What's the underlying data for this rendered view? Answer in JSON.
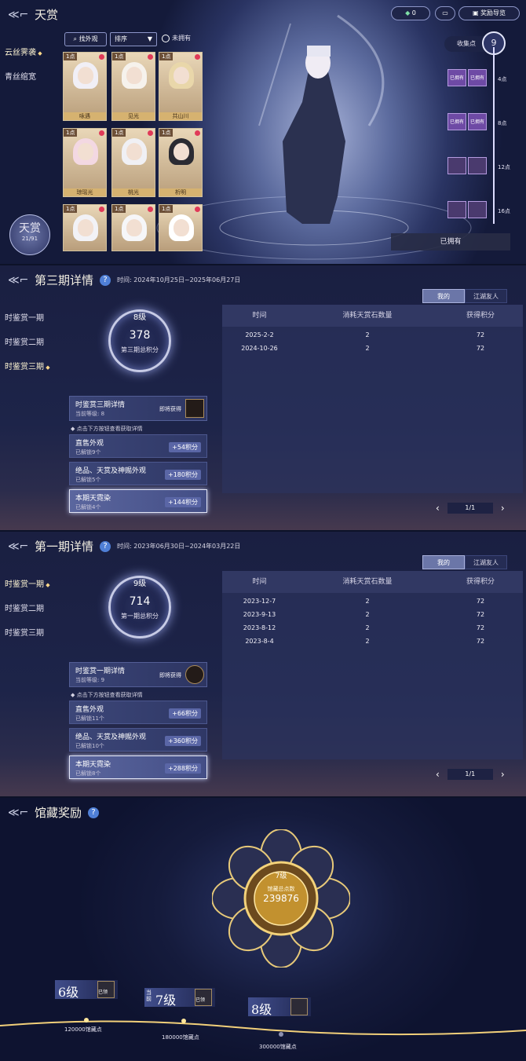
{
  "top": {
    "title": "天赏",
    "currency_value": "0",
    "reward_guide": "奖励导览",
    "categories": [
      "云丝霁袭",
      "青丝绾宽"
    ],
    "filter": {
      "find_look": "找外观",
      "sort": "排序",
      "not_owned": "未拥有"
    },
    "items": [
      {
        "badge": "1点",
        "name": "咏遇"
      },
      {
        "badge": "1点",
        "name": "见光"
      },
      {
        "badge": "1点",
        "name": "共山川"
      },
      {
        "badge": "1点",
        "name": "琼瑶光"
      },
      {
        "badge": "1点",
        "name": "桃光"
      },
      {
        "badge": "1点",
        "name": "析明"
      },
      {
        "badge": "1点",
        "name": ""
      },
      {
        "badge": "1点",
        "name": ""
      },
      {
        "badge": "1点",
        "name": ""
      }
    ],
    "tianshang_badge": {
      "title": "天赏",
      "count": "21/91"
    },
    "collect_label": "收集点",
    "collect_value": "9",
    "milestones": [
      "4点",
      "8点",
      "12点",
      "16点"
    ],
    "owned_tag": "已拥有",
    "owned_button": "已拥有"
  },
  "period3": {
    "title": "第三期详情",
    "time": "时间: 2024年10月25日~2025年06月27日",
    "side": [
      "时鉴赏一期",
      "时鉴赏二期",
      "时鉴赏三期"
    ],
    "ring": {
      "level": "8级",
      "score": "378",
      "caption": "第三期总积分"
    },
    "detail": {
      "title": "时鉴赏三期详情",
      "sub": "当前等级: 8",
      "right": "即将获得"
    },
    "hint": "点击下方按钮查看获取详情",
    "cards": [
      {
        "title": "直售外观",
        "sub": "已解锁9个",
        "points": "+54积分"
      },
      {
        "title": "绝品、天赏及神赐外观",
        "sub": "已解锁5个",
        "points": "+180积分"
      },
      {
        "title": "本期天霓染",
        "sub": "已解锁4个",
        "points": "+144积分"
      }
    ],
    "toggle": [
      "我的",
      "江湖友人"
    ],
    "headers": [
      "时间",
      "消耗天赏石数量",
      "获得积分"
    ],
    "rows": [
      [
        "2025-2-2",
        "2",
        "72"
      ],
      [
        "2024-10-26",
        "2",
        "72"
      ]
    ],
    "page": "1/1"
  },
  "period1": {
    "title": "第一期详情",
    "time": "时间: 2023年06月30日~2024年03月22日",
    "side": [
      "时鉴赏一期",
      "时鉴赏二期",
      "时鉴赏三期"
    ],
    "ring": {
      "level": "9级",
      "score": "714",
      "caption": "第一期总积分"
    },
    "detail": {
      "title": "时鉴赏一期详情",
      "sub": "当前等级: 9",
      "right": "即将获得"
    },
    "hint": "点击下方按钮查看获取详情",
    "cards": [
      {
        "title": "直售外观",
        "sub": "已解锁11个",
        "points": "+66积分"
      },
      {
        "title": "绝品、天赏及神赐外观",
        "sub": "已解锁10个",
        "points": "+360积分"
      },
      {
        "title": "本期天霓染",
        "sub": "已解锁8个",
        "points": "+288积分"
      }
    ],
    "toggle": [
      "我的",
      "江湖友人"
    ],
    "headers": [
      "时间",
      "消耗天赏石数量",
      "获得积分"
    ],
    "rows": [
      [
        "2023-12-7",
        "2",
        "72"
      ],
      [
        "2023-9-13",
        "2",
        "72"
      ],
      [
        "2023-8-12",
        "2",
        "72"
      ],
      [
        "2023-8-4",
        "2",
        "72"
      ]
    ],
    "page": "1/1"
  },
  "reward": {
    "title": "馆藏奖励",
    "center_level": "7级",
    "center_caption": "馆藏总点数",
    "center_value": "239876",
    "levels": [
      {
        "label": "6级",
        "points": "120000馆藏点",
        "tag": "已领"
      },
      {
        "label": "7级",
        "prefix": "当前",
        "points": "180000馆藏点",
        "tag": "已领"
      },
      {
        "label": "8级",
        "points": "300000馆藏点",
        "tag": ""
      }
    ]
  }
}
